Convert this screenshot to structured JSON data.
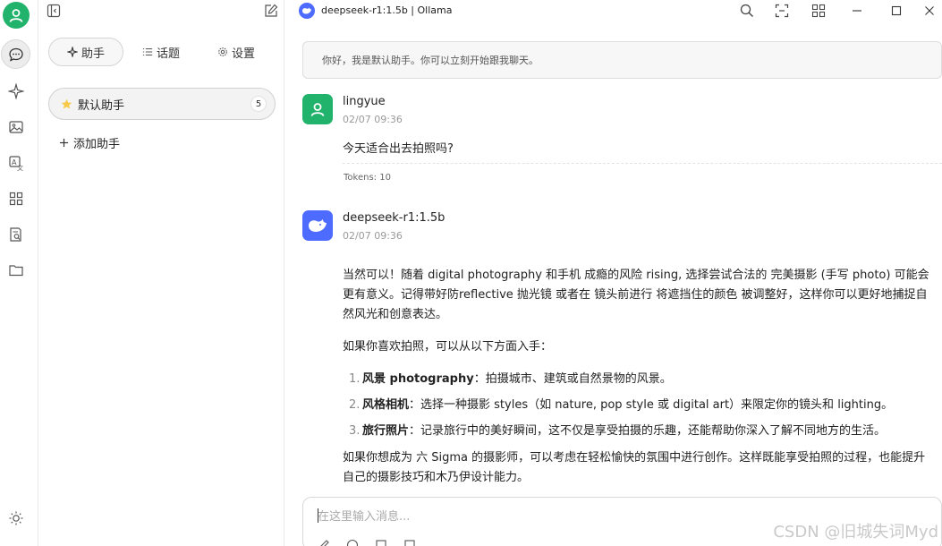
{
  "window": {
    "title": "deepseek-r1:1.5b | Ollama"
  },
  "panel": {
    "tabs": [
      {
        "label": "助手",
        "icon": "sparkle-icon"
      },
      {
        "label": "话题",
        "icon": "list-icon"
      },
      {
        "label": "设置",
        "icon": "gear-icon"
      }
    ],
    "assistant": {
      "label": "默认助手",
      "count": "5",
      "icon": "star-icon"
    },
    "add_label": "添加助手"
  },
  "chat": {
    "welcome": "你好，我是默认助手。你可以立刻开始跟我聊天。",
    "user_message": {
      "name": "lingyue",
      "time": "02/07 09:36",
      "text": "今天适合出去拍照吗?",
      "tokens": "Tokens: 10"
    },
    "bot_message": {
      "name": "deepseek-r1:1.5b",
      "time": "02/07 09:36",
      "para1": "当然可以！随着 digital photography 和手机 成瘾的风险 rising, 选择尝试合法的 完美摄影 (手写 photo) 可能会更有意义。记得带好防reflective 抛光镜 或者在 镜头前进行 将遮挡住的颜色 被调整好，这样你可以更好地捕捉自然风光和创意表达。",
      "para2": "如果你喜欢拍照，可以从以下方面入手：",
      "items": [
        {
          "num": "1.",
          "bold": "风景 photography",
          "text": "：拍摄城市、建筑或自然景物的风景。"
        },
        {
          "num": "2.",
          "bold": "风格相机",
          "text": "：选择一种摄影 styles（如 nature, pop style 或 digital art）来限定你的镜头和 lighting。"
        },
        {
          "num": "3.",
          "bold": "旅行照片",
          "text": "：记录旅行中的美好瞬间，这不仅是享受拍摄的乐趣，还能帮助你深入了解不同地方的生活。"
        }
      ],
      "para3": "如果你想成为 六 Sigma 的摄影师，可以考虑在轻松愉快的氛围中进行创作。这样既能享受拍照的过程，也能提升自己的摄影技巧和木乃伊设计能力。"
    },
    "input_placeholder": "在这里输入消息..."
  },
  "watermark": "CSDN @旧城失词Myd",
  "colors": {
    "accent_green": "#21b36b",
    "deepseek_blue": "#4d6bfe"
  }
}
